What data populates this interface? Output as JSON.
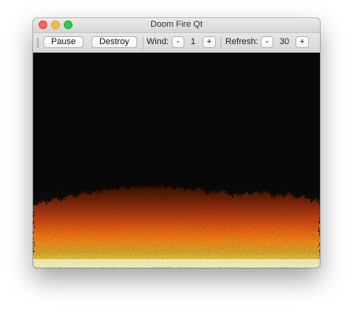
{
  "window": {
    "title": "Doom Fire Qt"
  },
  "toolbar": {
    "pause_label": "Pause",
    "destroy_label": "Destroy",
    "wind_label": "Wind:",
    "wind_value": "1",
    "wind_minus": "-",
    "wind_plus": "+",
    "refresh_label": "Refresh:",
    "refresh_value": "30",
    "refresh_minus": "-",
    "refresh_plus": "+"
  },
  "colors": {
    "close": "#fc605b",
    "minimize": "#fdbc40",
    "zoom": "#34c84a",
    "fire_dark": "#6b1d05",
    "fire_red": "#c2410c",
    "fire_orange": "#f07a10",
    "fire_yellow": "#e8c832",
    "fire_white": "#f2f0c8"
  }
}
